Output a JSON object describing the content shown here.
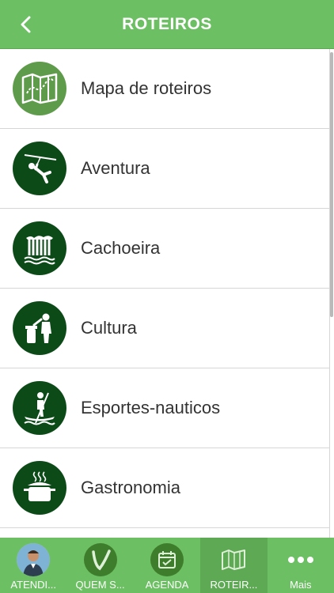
{
  "header": {
    "title": "ROTEIROS",
    "back_icon": "chevron-left-icon"
  },
  "list": {
    "items": [
      {
        "label": "Mapa de roteiros",
        "icon": "map-icon"
      },
      {
        "label": "Aventura",
        "icon": "zipline-icon"
      },
      {
        "label": "Cachoeira",
        "icon": "waterfall-icon"
      },
      {
        "label": "Cultura",
        "icon": "culture-icon"
      },
      {
        "label": "Esportes-nauticos",
        "icon": "paddleboard-icon"
      },
      {
        "label": "Gastronomia",
        "icon": "cooking-pot-icon"
      }
    ]
  },
  "tabbar": {
    "tabs": [
      {
        "label": "ATENDI...",
        "icon": "attendant-avatar-icon"
      },
      {
        "label": "QUEM S...",
        "icon": "v-logo-icon"
      },
      {
        "label": "AGENDA",
        "icon": "calendar-icon"
      },
      {
        "label": "ROTEIR...",
        "icon": "map-icon",
        "active": true
      },
      {
        "label": "Mais",
        "icon": "more-dots-icon"
      }
    ]
  },
  "colors": {
    "header": "#6cbf62",
    "icon_dark": "#0c4a18",
    "icon_light": "#5e9b4a",
    "tab_active": "#5ea954"
  }
}
